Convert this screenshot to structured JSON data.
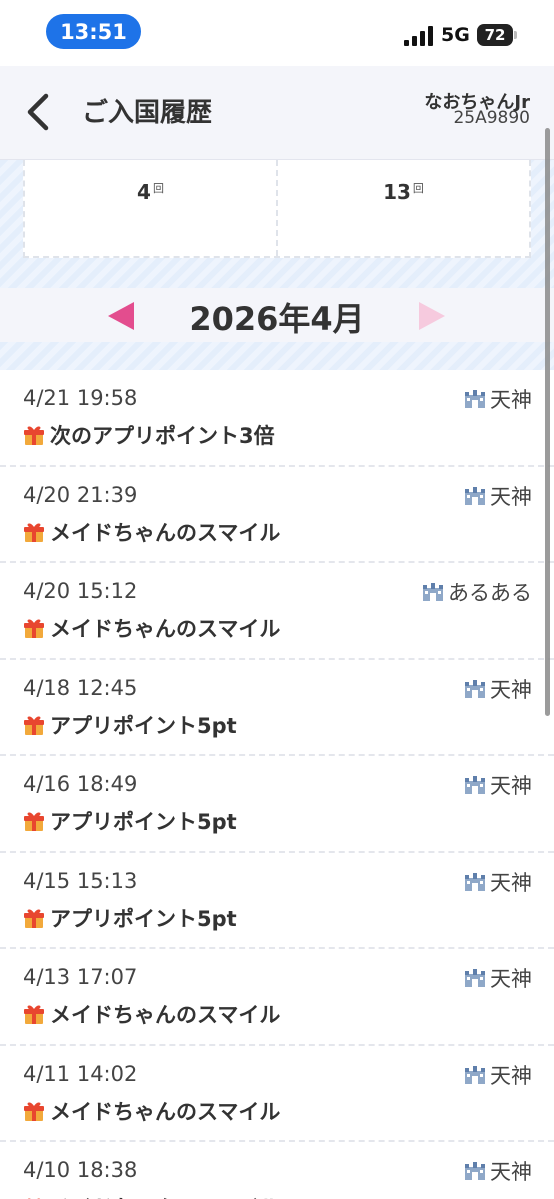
{
  "status_bar": {
    "time": "13:51",
    "network": "5G",
    "battery": "72",
    "icons": [
      "signal-icon",
      "battery-icon"
    ]
  },
  "header": {
    "title": "ご入国履歴",
    "user_name": "なおちゃんJr",
    "user_id": "25A9890",
    "icons": [
      "back-arrow-icon"
    ]
  },
  "summary": {
    "unit": "回",
    "cells": [
      {
        "value": "4"
      },
      {
        "value": "13"
      }
    ]
  },
  "month_nav": {
    "label": "2026年4月",
    "colors": {
      "prev": "#e34d8e",
      "next": "#f6cade"
    }
  },
  "visits": [
    {
      "datetime": "4/21 19:58",
      "location": "天神",
      "reward": "次のアプリポイント3倍"
    },
    {
      "datetime": "4/20 21:39",
      "location": "天神",
      "reward": "メイドちゃんのスマイル"
    },
    {
      "datetime": "4/20 15:12",
      "location": "あるある",
      "reward": "メイドちゃんのスマイル"
    },
    {
      "datetime": "4/18 12:45",
      "location": "天神",
      "reward": "アプリポイント5pt"
    },
    {
      "datetime": "4/16 18:49",
      "location": "天神",
      "reward": "アプリポイント5pt"
    },
    {
      "datetime": "4/15 15:13",
      "location": "天神",
      "reward": "アプリポイント5pt"
    },
    {
      "datetime": "4/13 17:07",
      "location": "天神",
      "reward": "メイドちゃんのスマイル"
    },
    {
      "datetime": "4/11 14:02",
      "location": "天神",
      "reward": "メイドちゃんのスマイル"
    },
    {
      "datetime": "4/10 18:38",
      "location": "天神",
      "reward": "メイドちゃんのスマイル"
    }
  ],
  "list_icons": {
    "location": "castle-icon",
    "reward": "gift-icon"
  }
}
